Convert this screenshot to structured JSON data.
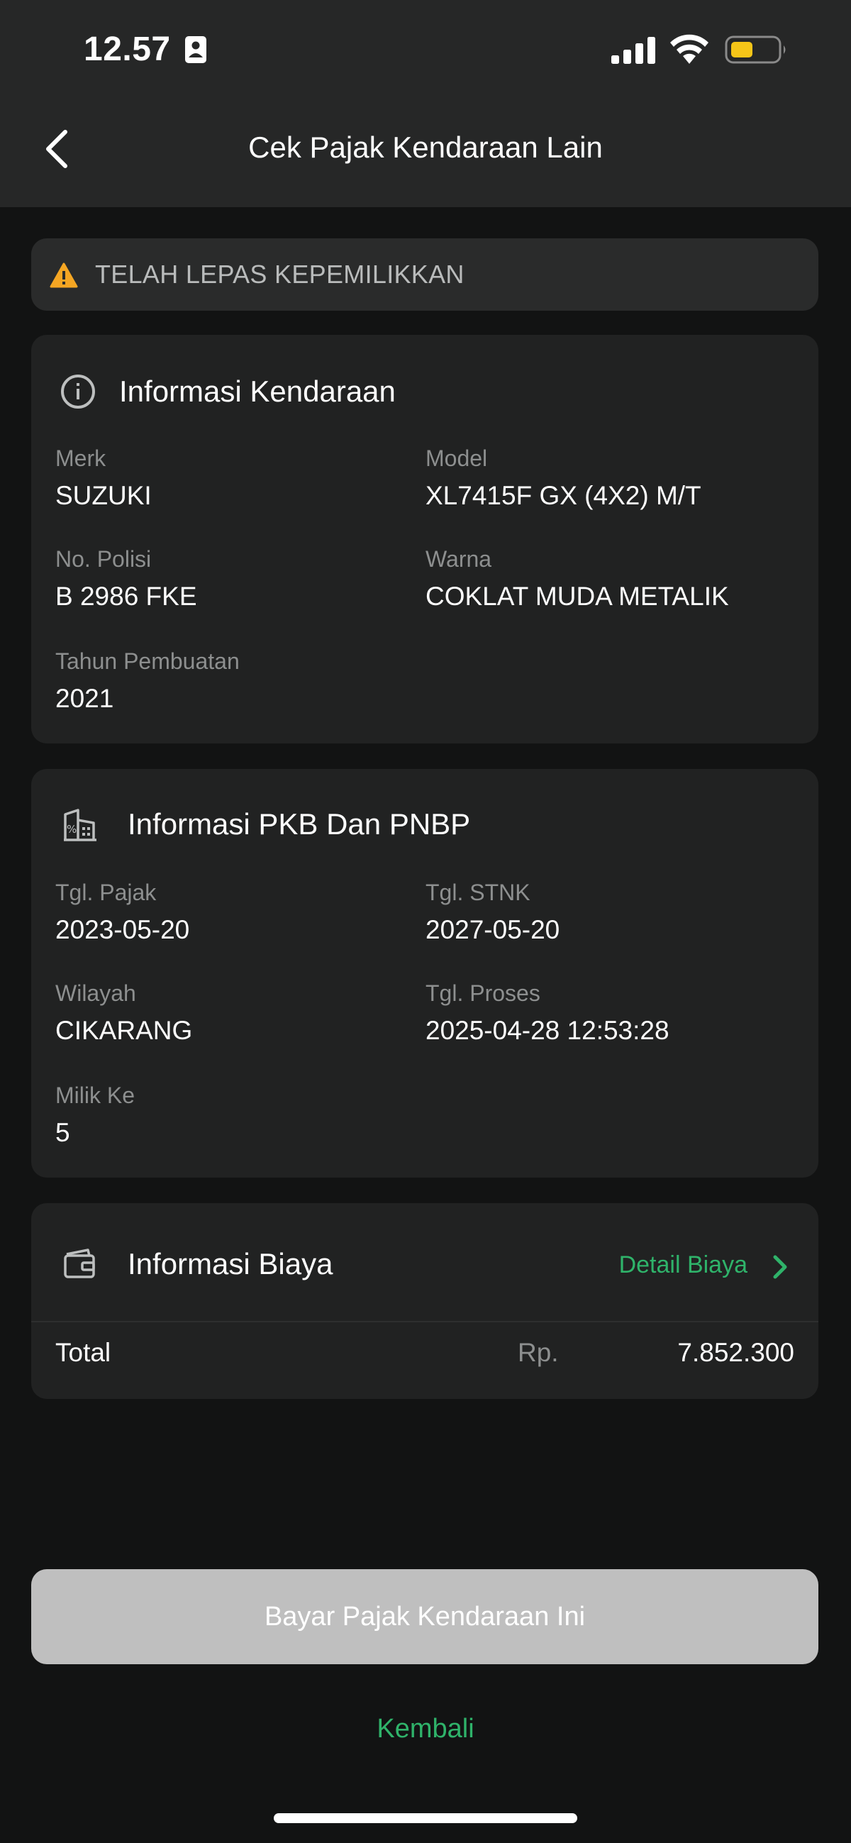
{
  "status_bar": {
    "time": "12.57",
    "icons": [
      "contact-card-icon",
      "signal-icon",
      "wifi-icon",
      "battery-low-icon"
    ],
    "battery_color": "#f5c518"
  },
  "header": {
    "title": "Cek Pajak Kendaraan Lain",
    "back_icon": "chevron-left-icon"
  },
  "alert": {
    "icon": "warning-icon",
    "icon_color": "#f5a623",
    "text": "TELAH LEPAS KEPEMILIKKAN"
  },
  "vehicle_info": {
    "icon": "info-icon",
    "title": "Informasi Kendaraan",
    "fields": [
      {
        "label": "Merk",
        "value": "SUZUKI"
      },
      {
        "label": "Model",
        "value": "XL7415F GX (4X2) M/T"
      },
      {
        "label": "No. Polisi",
        "value": "B 2986 FKE"
      },
      {
        "label": "Warna",
        "value": "COKLAT MUDA METALIK"
      },
      {
        "label": "Tahun Pembuatan",
        "value": "2021"
      }
    ]
  },
  "pkb_info": {
    "icon": "tax-building-icon",
    "title": "Informasi PKB Dan PNBP",
    "fields": [
      {
        "label": "Tgl. Pajak",
        "value": "2023-05-20"
      },
      {
        "label": "Tgl. STNK",
        "value": "2027-05-20"
      },
      {
        "label": "Wilayah",
        "value": "CIKARANG"
      },
      {
        "label": "Tgl. Proses",
        "value": "2025-04-28 12:53:28"
      },
      {
        "label": "Milik Ke",
        "value": "5"
      }
    ]
  },
  "cost_info": {
    "icon": "wallet-icon",
    "title": "Informasi Biaya",
    "detail_link": "Detail Biaya",
    "total_label": "Total",
    "currency": "Rp.",
    "total_amount": "7.852.300"
  },
  "actions": {
    "pay_button": "Bayar Pajak Kendaraan Ini",
    "back_link": "Kembali"
  },
  "colors": {
    "accent_green": "#2fb36a",
    "background": "#121313",
    "card": "#212222",
    "header": "#262727",
    "disabled_button": "#bfbfbf"
  }
}
